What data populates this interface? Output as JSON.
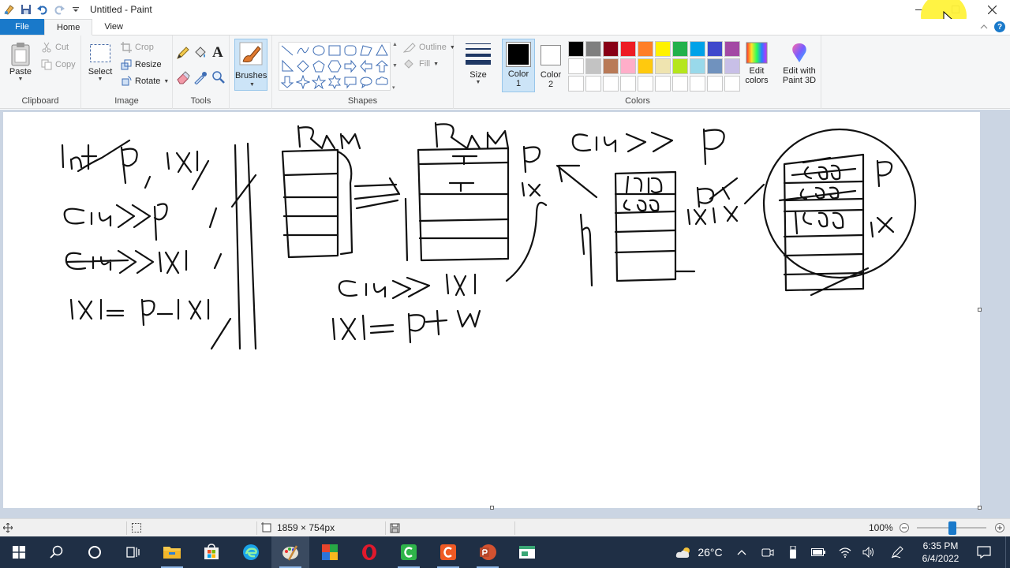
{
  "window": {
    "title": "Untitled - Paint"
  },
  "menu": {
    "file": "File",
    "home": "Home",
    "view": "View"
  },
  "ribbon": {
    "clipboard": {
      "label": "Clipboard",
      "paste": "Paste",
      "cut": "Cut",
      "copy": "Copy"
    },
    "image": {
      "label": "Image",
      "select": "Select",
      "crop": "Crop",
      "resize": "Resize",
      "rotate": "Rotate"
    },
    "tools": {
      "label": "Tools"
    },
    "brushes": {
      "label": "Brushes"
    },
    "shapes": {
      "label": "Shapes",
      "outline": "Outline",
      "fill": "Fill"
    },
    "size": {
      "label": "Size"
    },
    "colors": {
      "label": "Colors",
      "color1": "Color",
      "color1_num": "1",
      "color2": "Color",
      "color2_num": "2",
      "edit_colors_1": "Edit",
      "edit_colors_2": "colors",
      "paint3d_1": "Edit with",
      "paint3d_2": "Paint 3D",
      "color1_value": "#000000",
      "color2_value": "#ffffff",
      "palette": [
        "#000000",
        "#7f7f7f",
        "#880015",
        "#ed1c24",
        "#ff7f27",
        "#fff200",
        "#22b14c",
        "#00a2e8",
        "#3f48cc",
        "#a349a4",
        "#ffffff",
        "#c3c3c3",
        "#b97a57",
        "#ffaec9",
        "#ffc90e",
        "#efe4b0",
        "#b5e61d",
        "#99d9ea",
        "#7092be",
        "#c8bfe7",
        "#ffffff",
        "#ffffff",
        "#ffffff",
        "#ffffff",
        "#ffffff",
        "#ffffff",
        "#ffffff",
        "#ffffff",
        "#ffffff",
        "#ffffff"
      ]
    }
  },
  "status": {
    "canvas_size": "1859 × 754px",
    "zoom": "100%"
  },
  "taskbar": {
    "weather": "26°C",
    "time": "6:35 PM",
    "date": "6/4/2022"
  }
}
